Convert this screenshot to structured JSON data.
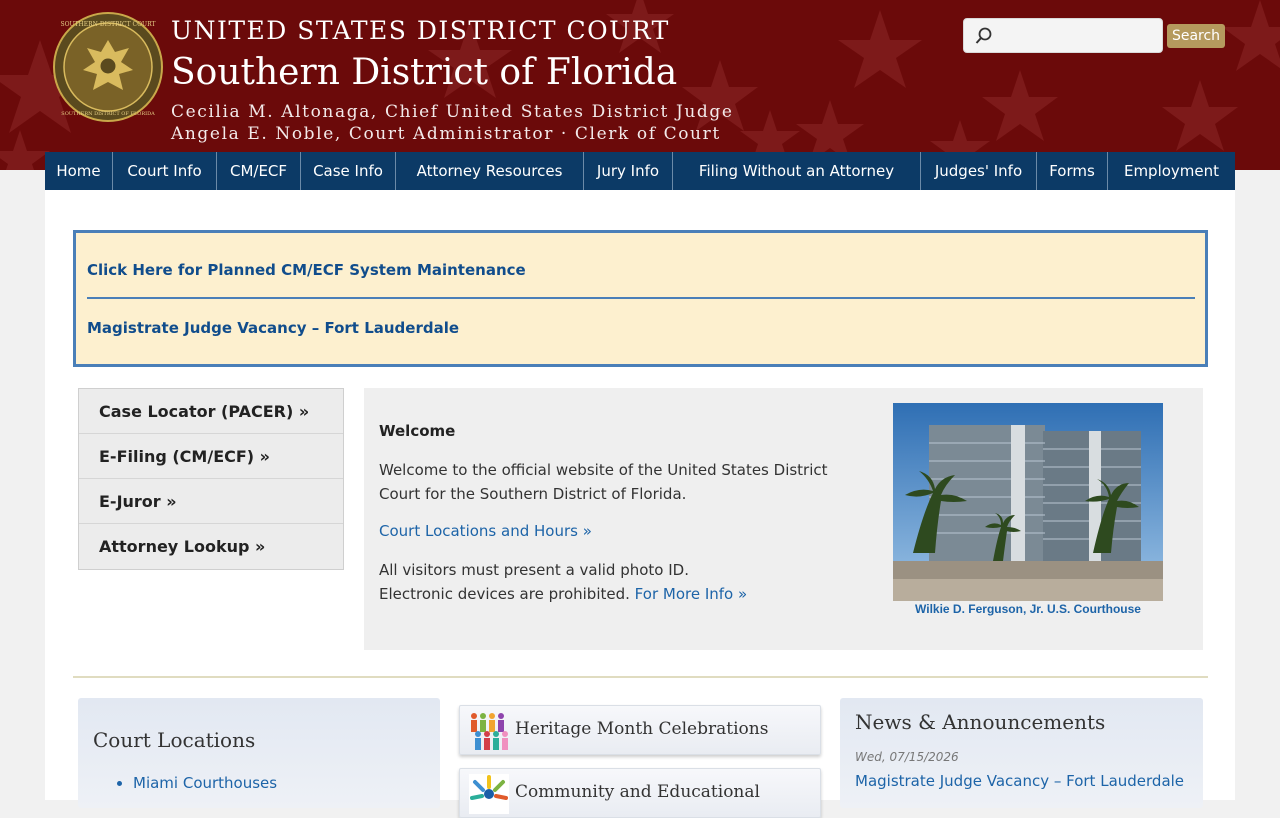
{
  "header": {
    "line1": "UNITED STATES DISTRICT COURT",
    "line2": "Southern District of Florida",
    "line3": "Cecilia M. Altonaga, Chief United States District Judge",
    "line4": "Angela E. Noble, Court Administrator · Clerk of Court",
    "seal_text_top": "SOUTHERN DISTRICT COURT",
    "seal_text_bottom": "SOUTHERN DISTRICT OF FLORIDA",
    "colors": {
      "banner": "#6b0a0a",
      "nav": "#0c3a66",
      "accent": "#b59a5e"
    }
  },
  "search": {
    "placeholder": "",
    "button_label": "Search",
    "icon": "search-icon"
  },
  "nav": {
    "items": [
      {
        "label": "Home"
      },
      {
        "label": "Court Info"
      },
      {
        "label": "CM/ECF"
      },
      {
        "label": "Case Info"
      },
      {
        "label": "Attorney Resources"
      },
      {
        "label": "Jury Info"
      },
      {
        "label": "Filing Without an Attorney"
      },
      {
        "label": "Judges' Info"
      },
      {
        "label": "Forms"
      },
      {
        "label": "Employment"
      }
    ]
  },
  "alerts": [
    {
      "label": "Click Here for Planned CM/ECF System Maintenance"
    },
    {
      "label": "Magistrate Judge Vacancy – Fort Lauderdale"
    }
  ],
  "quick_links": [
    {
      "label": "Case Locator (PACER) »"
    },
    {
      "label": "E-Filing (CM/ECF) »"
    },
    {
      "label": "E-Juror »"
    },
    {
      "label": "Attorney Lookup »"
    }
  ],
  "welcome": {
    "title": "Welcome",
    "text": "Welcome to the official website of the United States District Court for the Southern District of Florida.",
    "locations_link": "Court Locations and Hours »",
    "visitor_note": "All visitors must present a valid photo ID.",
    "devices_note": "Electronic devices are prohibited.",
    "more_info_link": "For More Info »",
    "image_caption": "Wilkie D. Ferguson, Jr. U.S. Courthouse"
  },
  "court_locations": {
    "title": "Court Locations",
    "items": [
      {
        "label": "Miami Courthouses"
      }
    ]
  },
  "features": [
    {
      "label": "Heritage Month Celebrations",
      "icon": "people-icon"
    },
    {
      "label": "Community and Educational",
      "icon": "outreach-icon"
    }
  ],
  "news": {
    "title": "News & Announcements",
    "date": "Wed, 07/15/2026",
    "link": "Magistrate Judge Vacancy – Fort Lauderdale"
  }
}
